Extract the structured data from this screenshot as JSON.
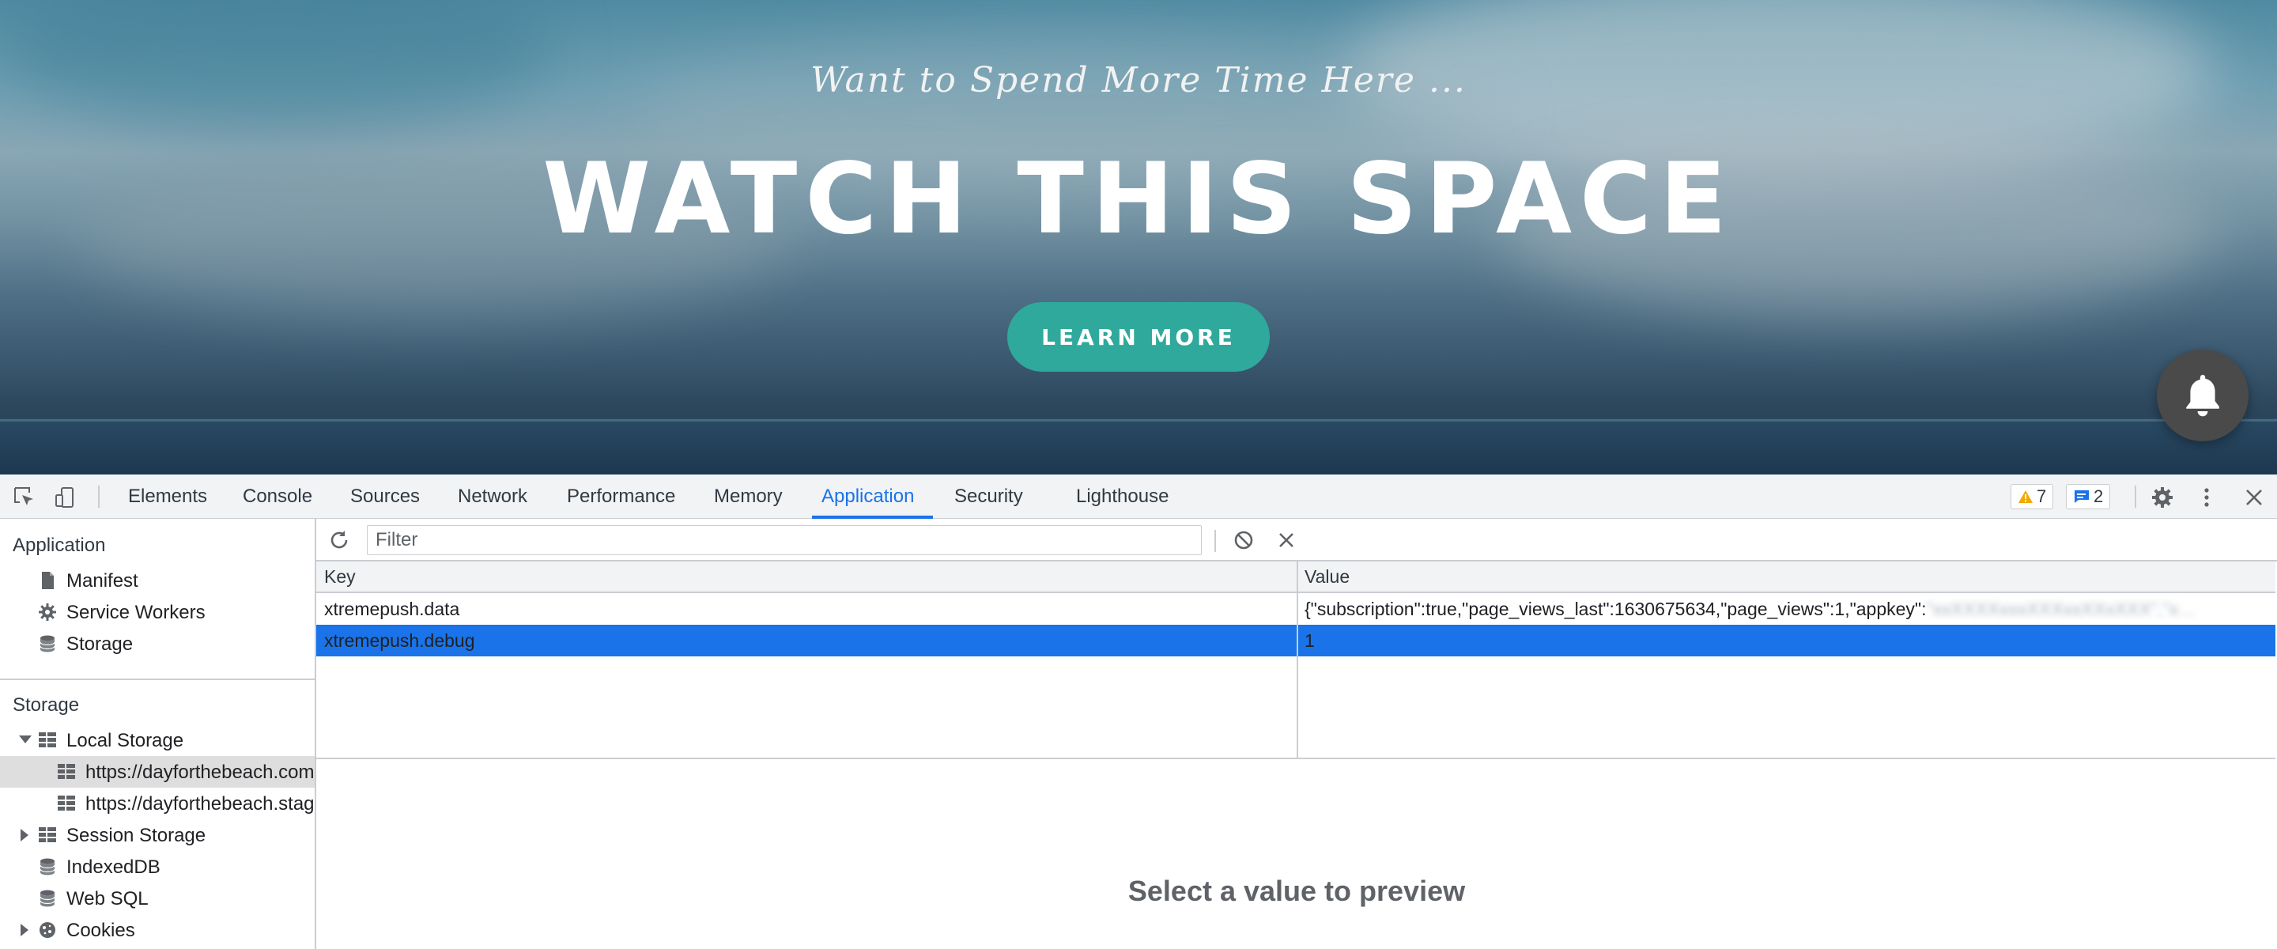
{
  "hero": {
    "subtitle": "Want to Spend More Time Here ...",
    "title": "WATCH THIS SPACE",
    "cta_label": "LEARN MORE",
    "cta_color": "#2fa99b",
    "notification_icon": "bell-icon"
  },
  "devtools": {
    "tabs": [
      {
        "label": "Elements"
      },
      {
        "label": "Console"
      },
      {
        "label": "Sources"
      },
      {
        "label": "Network"
      },
      {
        "label": "Performance"
      },
      {
        "label": "Memory"
      },
      {
        "label": "Application",
        "active": true
      },
      {
        "label": "Security"
      },
      {
        "label": "Lighthouse"
      }
    ],
    "warnings_count": "7",
    "messages_count": "2",
    "accent_color": "#1a73e8"
  },
  "sidebar": {
    "application_heading": "Application",
    "application_items": [
      {
        "label": "Manifest",
        "icon": "file-icon"
      },
      {
        "label": "Service Workers",
        "icon": "gear-icon"
      },
      {
        "label": "Storage",
        "icon": "database-icon"
      }
    ],
    "storage_heading": "Storage",
    "local_storage_label": "Local Storage",
    "local_storage_origins": [
      "https://dayforthebeach.com",
      "https://dayforthebeach.staging"
    ],
    "session_storage_label": "Session Storage",
    "indexeddb_label": "IndexedDB",
    "websql_label": "Web SQL",
    "cookies_label": "Cookies"
  },
  "main": {
    "filter_placeholder": "Filter",
    "columns": {
      "key": "Key",
      "value": "Value"
    },
    "rows": [
      {
        "key": "xtremepush.data",
        "value": "{\"subscription\":true,\"page_views_last\":1630675634,\"page_views\":1,\"appkey\":",
        "value_redacted": "\"xxXXXXxxxXXXxxXXxXXX\",\"x…"
      },
      {
        "key": "xtremepush.debug",
        "value": "1",
        "selected": true
      }
    ],
    "preview_text": "Select a value to preview"
  }
}
